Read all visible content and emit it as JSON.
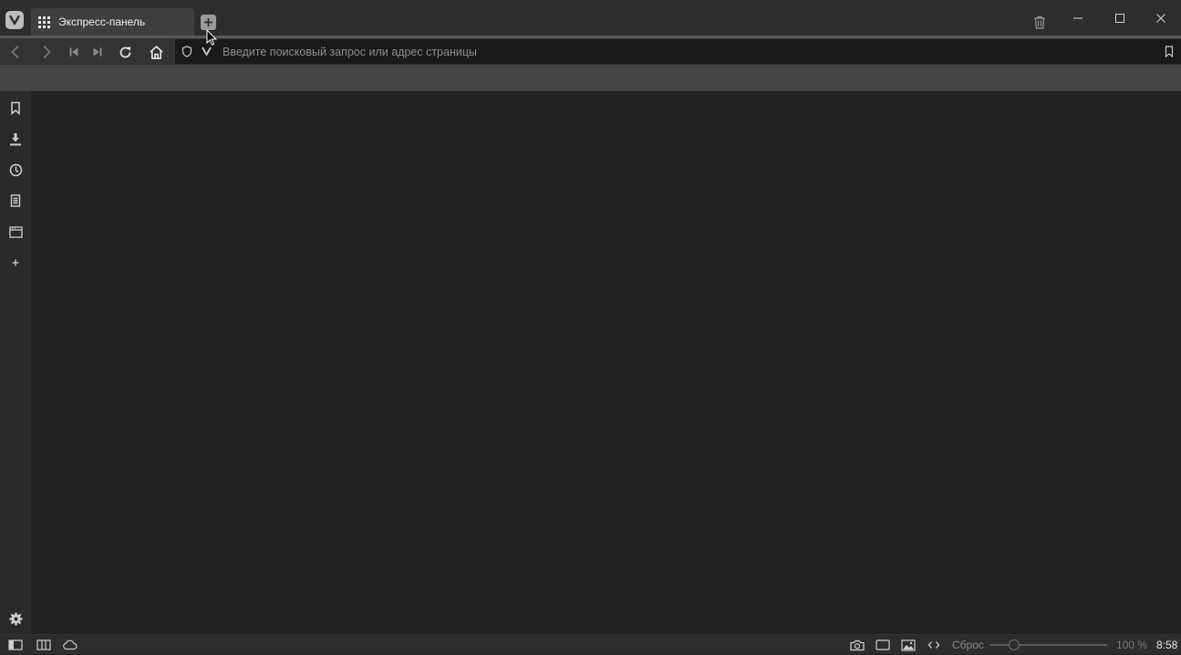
{
  "window": {
    "active_tab_title": "Экспресс-панель",
    "icons": {
      "logo": "vivaldi-logo-icon",
      "tab": "speed-dial-grid-icon",
      "new_tab": "plus-icon",
      "trash": "trash-icon",
      "minimize": "minimize-icon",
      "maximize": "maximize-icon",
      "close": "close-icon"
    }
  },
  "addressbar": {
    "placeholder": "Введите поисковый запрос или адрес страницы",
    "icons": [
      "back-icon",
      "forward-icon",
      "rewind-icon",
      "fast-forward-icon",
      "reload-icon",
      "home-icon",
      "shield-icon",
      "vivaldi-v-icon",
      "bookmark-icon"
    ]
  },
  "sidepanel": {
    "items": [
      "bookmarks-icon",
      "downloads-icon",
      "history-icon",
      "notes-icon",
      "window-panel-icon",
      "add-panel-icon"
    ],
    "settings": "gear-icon"
  },
  "statusbar": {
    "icons_left": [
      "panel-toggle-icon",
      "tile-tabs-icon",
      "sync-cloud-icon"
    ],
    "icons_right": [
      "camera-icon",
      "page-tiling-icon",
      "image-icon",
      "code-icon"
    ],
    "reset_label": "Сброс",
    "zoom_fraction": 0.2,
    "zoom_text": "100 %",
    "clock": "8:58"
  },
  "colors": {
    "tabbar": "#2d2d2d",
    "active_tab": "#3f3f3f",
    "urlfield": "#1a1a1a",
    "content": "#222222",
    "icon": "#bdbdbd"
  }
}
